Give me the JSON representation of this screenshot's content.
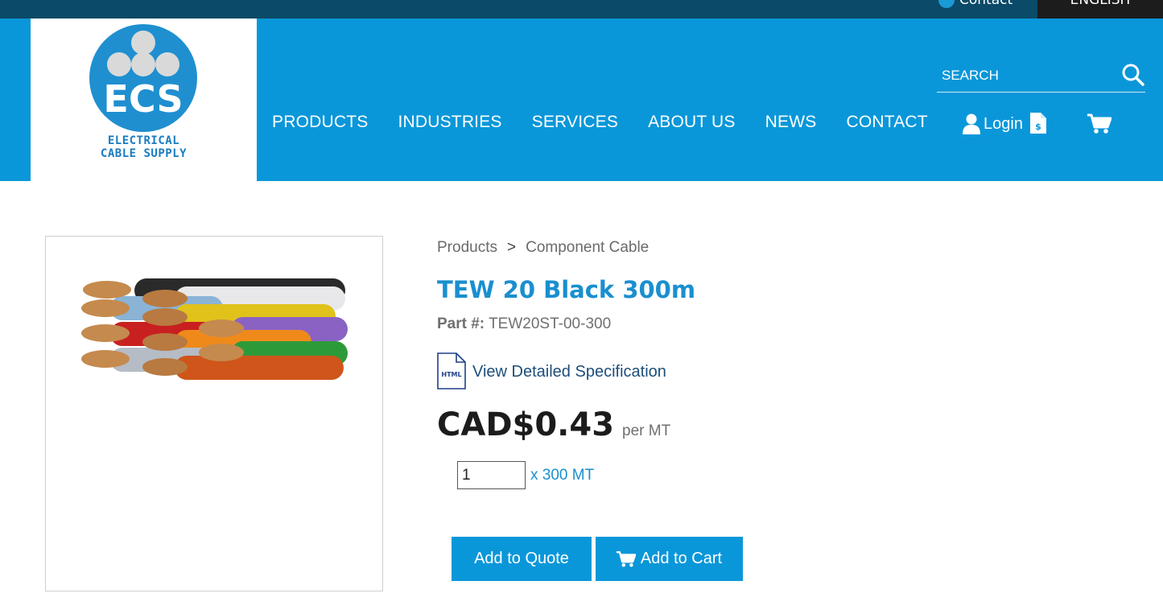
{
  "topbar": {
    "contact_label": "Contact",
    "language_label": "ENGLISH"
  },
  "brand": {
    "logo_letters": "ECS",
    "logo_line1": "ELECTRICAL",
    "logo_line2": "CABLE SUPPLY",
    "primary_color": "#0a97d9",
    "dark_color": "#0b4a68"
  },
  "nav": {
    "items": [
      {
        "label": "PRODUCTS"
      },
      {
        "label": "INDUSTRIES"
      },
      {
        "label": "SERVICES"
      },
      {
        "label": "ABOUT US"
      },
      {
        "label": "NEWS"
      },
      {
        "label": "CONTACT"
      }
    ]
  },
  "search": {
    "placeholder": "SEARCH",
    "value": ""
  },
  "account": {
    "login_label": "Login"
  },
  "product": {
    "breadcrumb": [
      "Products",
      "Component Cable"
    ],
    "breadcrumb_separator": ">",
    "title": "TEW 20 Black 300m",
    "part_label": "Part #:",
    "part_number": "TEW20ST-00-300",
    "spec_badge": "HTML",
    "spec_link": "View Detailed Specification",
    "price": "CAD$0.43",
    "price_unit": "per MT",
    "quantity": "1",
    "quantity_multiplier": "x 300 MT",
    "add_to_quote": "Add to Quote",
    "add_to_cart": "Add to Cart"
  }
}
